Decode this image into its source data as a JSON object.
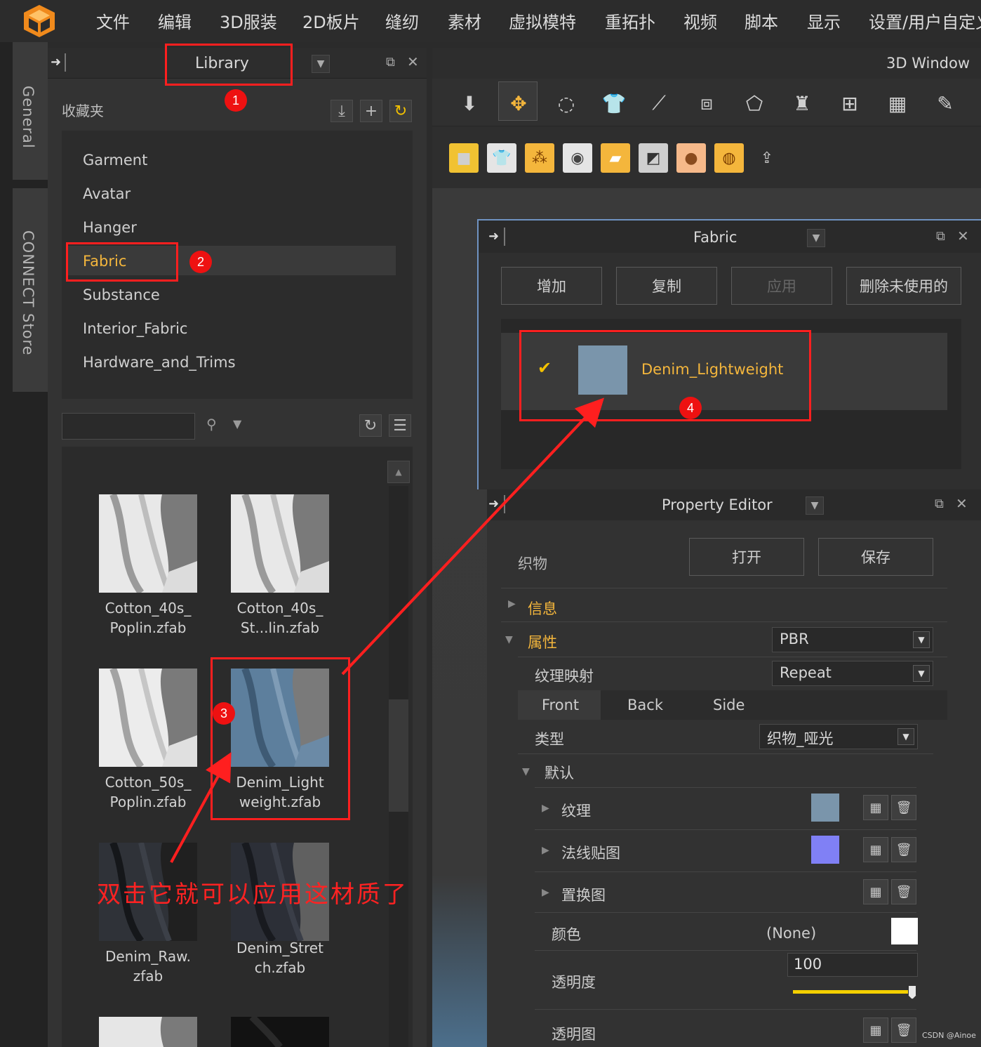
{
  "menu": {
    "items": [
      "文件",
      "编辑",
      "3D服装",
      "2D板片",
      "缝纫",
      "素材",
      "虚拟模特",
      "重拓扑",
      "视频",
      "脚本",
      "显示",
      "设置/用户自定义"
    ]
  },
  "side_tabs": {
    "general": "General",
    "connect": "CONNECT Store"
  },
  "library": {
    "title": "Library",
    "favorites_label": "收藏夹",
    "favorites": [
      "Garment",
      "Avatar",
      "Hanger",
      "Fabric",
      "Substance",
      "Interior_Fabric",
      "Hardware_and_Trims"
    ],
    "selected_favorite": "Fabric",
    "search_placeholder": "",
    "thumbnails": [
      {
        "label": "Cotton_40s_\nPoplin.zfab"
      },
      {
        "label": "Cotton_40s_\nSt...lin.zfab"
      },
      {
        "label": "Cotton_50s_\nPoplin.zfab"
      },
      {
        "label": "Denim_Light\nweight.zfab"
      },
      {
        "label": "Denim_Raw.\nzfab"
      },
      {
        "label": "Denim_Stret\nch.zfab"
      }
    ]
  },
  "window3d": {
    "title": "3D Window"
  },
  "fabric_panel": {
    "title": "Fabric",
    "buttons": {
      "add": "增加",
      "copy": "复制",
      "apply": "应用",
      "delete_unused": "删除未使用的"
    },
    "items": [
      {
        "name": "Denim_Lightweight",
        "color": "#7a95ab",
        "checked": true
      }
    ]
  },
  "property_editor": {
    "title": "Property Editor",
    "fabric_label": "织物",
    "open_btn": "打开",
    "save_btn": "保存",
    "info_label": "信息",
    "attributes_label": "属性",
    "shader_value": "PBR",
    "texture_mapping_label": "纹理映射",
    "texture_mapping_value": "Repeat",
    "tabs": [
      "Front",
      "Back",
      "Side"
    ],
    "type_label": "类型",
    "type_value": "织物_哑光",
    "default_label": "默认",
    "texture_label": "纹理",
    "texture_color": "#7a95ab",
    "normal_map_label": "法线贴图",
    "normal_color": "#8080f5",
    "displacement_label": "置换图",
    "color_label": "颜色",
    "color_value": "(None)",
    "opacity_label": "透明度",
    "opacity_value": "100",
    "opacity_fraction": 1.0,
    "opacity_map_label": "透明图"
  },
  "annotations": {
    "badge1": "1",
    "badge2": "2",
    "badge3": "3",
    "badge4": "4",
    "instruction": "双击它就可以应用这材质了"
  },
  "watermark": "CSDN @Ainoe",
  "colors": {
    "accent": "#f4b63c",
    "annotation": "#ff1f1f"
  }
}
